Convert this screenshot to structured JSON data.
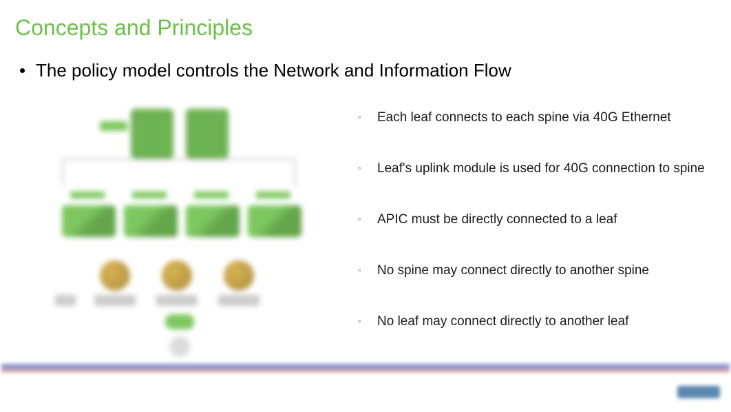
{
  "title": "Concepts and Principles",
  "main_bullet": "The policy model controls the Network and Information Flow",
  "sub_bullets": [
    "Each leaf connects to each spine via 40G Ethernet",
    "Leaf's uplink module is used for 40G connection to spine",
    "APIC must be directly connected to a leaf",
    "No spine may connect directly to another spine",
    "No leaf may connect directly to another leaf"
  ]
}
